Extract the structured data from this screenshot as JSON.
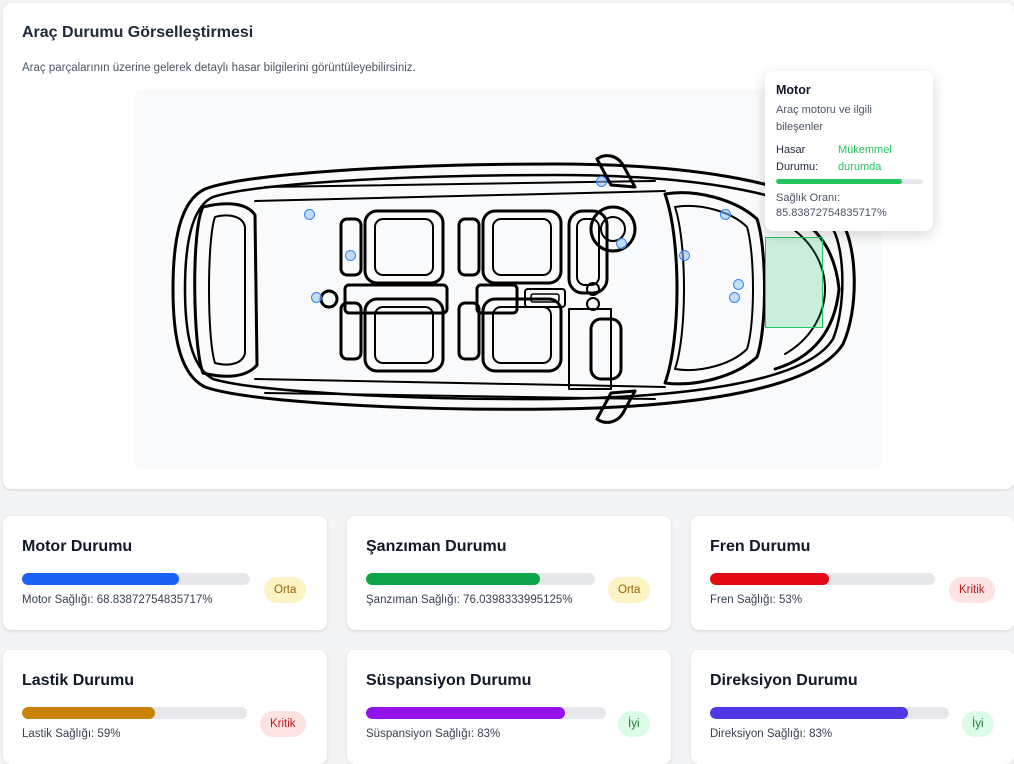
{
  "visualization": {
    "title": "Araç Durumu Görselleştirmesi",
    "description": "Araç parçalarının üzerine gelerek detaylı hasar bilgilerini görüntüleyebilirsiniz."
  },
  "tooltip": {
    "title": "Motor",
    "description": "Araç motoru ve ilgili bileşenler",
    "damage_label": "Hasar Durumu:",
    "damage_value": "Mükemmel durumda",
    "damage_color": "#22c55e",
    "health_fraction": 0.8583872754835717,
    "health_ratio_label": "Sağlık Oranı:",
    "health_ratio_value": "85.83872754835717%"
  },
  "hotspots": [
    {
      "part": "hotspot-1"
    },
    {
      "part": "hotspot-2"
    },
    {
      "part": "hotspot-3"
    },
    {
      "part": "hotspot-4"
    },
    {
      "part": "hotspot-5"
    },
    {
      "part": "hotspot-6"
    },
    {
      "part": "hotspot-7"
    },
    {
      "part": "hotspot-8"
    },
    {
      "part": "hotspot-9"
    }
  ],
  "stats": [
    {
      "name": "motor",
      "title": "Motor Durumu",
      "label": "Motor Sağlığı: 68.83872754835717%",
      "fraction": 0.6883872754835717,
      "color": "#1a62f5",
      "badge": "Orta",
      "badge_bg": "#fdf3c4",
      "badge_fg": "#a16207"
    },
    {
      "name": "transmission",
      "title": "Şanzıman Durumu",
      "label": "Şanzıman Sağlığı: 76.0398333995125%",
      "fraction": 0.760398333995125,
      "color": "#0ea54a",
      "badge": "Orta",
      "badge_bg": "#fdf3c4",
      "badge_fg": "#a16207"
    },
    {
      "name": "brake",
      "title": "Fren Durumu",
      "label": "Fren Sağlığı: 53%",
      "fraction": 0.53,
      "color": "#e20b14",
      "badge": "Kritik",
      "badge_bg": "#fde2e2",
      "badge_fg": "#b91c1c"
    },
    {
      "name": "tire",
      "title": "Lastik Durumu",
      "label": "Lastik Sağlığı: 59%",
      "fraction": 0.59,
      "color": "#ca8204",
      "badge": "Kritik",
      "badge_bg": "#fde2e2",
      "badge_fg": "#b91c1c"
    },
    {
      "name": "suspension",
      "title": "Süspansiyon Durumu",
      "label": "Süspansiyon Sağlığı: 83%",
      "fraction": 0.83,
      "color": "#9313ea",
      "badge": "İyi",
      "badge_bg": "#dcfce7",
      "badge_fg": "#15803d"
    },
    {
      "name": "steering",
      "title": "Direksiyon Durumu",
      "label": "Direksiyon Sağlığı: 83%",
      "fraction": 0.83,
      "color": "#4f38e6",
      "badge": "İyi",
      "badge_bg": "#dcfce7",
      "badge_fg": "#15803d"
    }
  ]
}
